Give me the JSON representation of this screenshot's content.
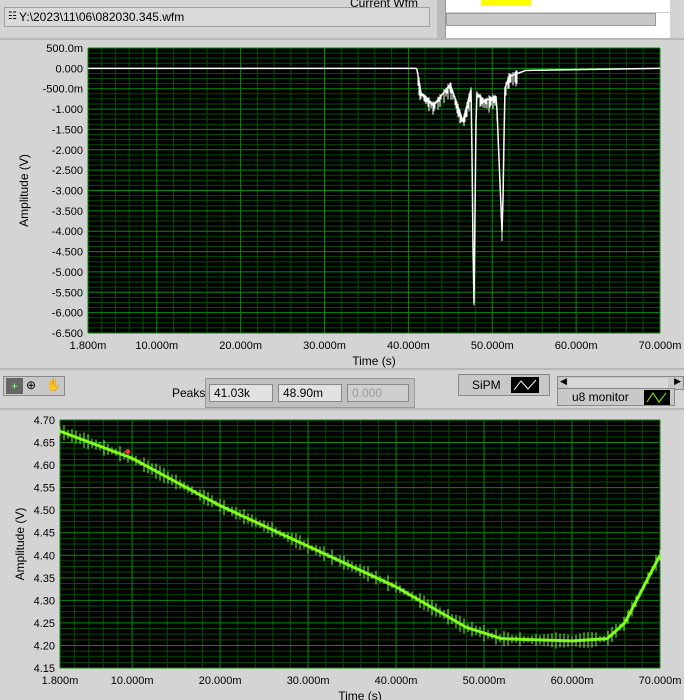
{
  "file_path": "Y:\\2023\\11\\06\\082030.345.wfm",
  "current_wfm_label": "Current Wfm",
  "toolbar": {
    "peaks_label": "Peaks",
    "peaks_values": [
      "41.03k",
      "48.90m",
      "0.000"
    ],
    "sipm_label": "SiPM",
    "u8_label": "u8 monitor",
    "tools": [
      "cursor-tool",
      "zoom-tool",
      "pan-tool"
    ]
  },
  "colors": {
    "plot_bg": "#000000",
    "grid_major": "#0a8a0a",
    "grid_minor": "#034d03",
    "trace1": "#ffffff",
    "trace2": "#7fff20",
    "cursor": "#ff3030"
  },
  "chart_data": [
    {
      "type": "line",
      "xlabel": "Time (s)",
      "ylabel": "Amplitude (V)",
      "xlim": [
        0.0018,
        0.07
      ],
      "ylim": [
        -6.5,
        0.5
      ],
      "grid": true,
      "xticks": [
        "1.800m",
        "10.000m",
        "20.000m",
        "30.000m",
        "40.000m",
        "50.000m",
        "60.000m",
        "70.000m"
      ],
      "yticks": [
        "500.0m",
        "0.000",
        "-500.0m",
        "-1.000",
        "-1.500",
        "-2.000",
        "-2.500",
        "-3.000",
        "-3.500",
        "-4.000",
        "-4.500",
        "-5.000",
        "-5.500",
        "-6.000",
        "-6.500"
      ],
      "x": [
        0.0018,
        0.041,
        0.0415,
        0.043,
        0.045,
        0.0465,
        0.0475,
        0.0478,
        0.0481,
        0.049,
        0.0505,
        0.0512,
        0.0515,
        0.052,
        0.054,
        0.07
      ],
      "y": [
        0,
        0,
        -0.6,
        -0.9,
        -0.4,
        -1.3,
        -0.5,
        -6.2,
        -0.6,
        -0.8,
        -0.7,
        -4.2,
        -0.5,
        -0.2,
        -0.05,
        0
      ]
    },
    {
      "type": "line",
      "xlabel": "Time (s)",
      "ylabel": "Amplitude (V)",
      "xlim": [
        0.0018,
        0.07
      ],
      "ylim": [
        4.15,
        4.7
      ],
      "grid": true,
      "xticks": [
        "1.800m",
        "10.000m",
        "20.000m",
        "30.000m",
        "40.000m",
        "50.000m",
        "60.000m",
        "70.000m"
      ],
      "yticks": [
        "4.70",
        "4.65",
        "4.60",
        "4.55",
        "4.50",
        "4.45",
        "4.40",
        "4.35",
        "4.30",
        "4.25",
        "4.20",
        "4.15"
      ],
      "x": [
        0.0018,
        0.01,
        0.02,
        0.03,
        0.04,
        0.048,
        0.052,
        0.06,
        0.064,
        0.066,
        0.07
      ],
      "y": [
        4.675,
        4.615,
        4.51,
        4.42,
        4.33,
        4.24,
        4.215,
        4.21,
        4.215,
        4.25,
        4.4
      ],
      "cursor": {
        "x": 0.0095,
        "y": 4.63
      }
    }
  ]
}
